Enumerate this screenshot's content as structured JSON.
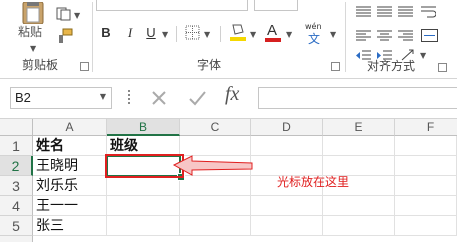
{
  "ribbon": {
    "clipboard": {
      "group_label": "剪贴板",
      "paste_label": "粘贴"
    },
    "font": {
      "group_label": "字体",
      "bold_label": "B",
      "italic_label": "I",
      "underline_label": "U",
      "font_color_glyph": "A",
      "phonetic_label": "wén"
    },
    "alignment": {
      "group_label": "对齐方式"
    }
  },
  "formula_bar": {
    "name_box": "B2",
    "fx_label": "fx",
    "content": ""
  },
  "sheet": {
    "columns": [
      "A",
      "B",
      "C",
      "D",
      "E",
      "F"
    ],
    "rows": [
      "1",
      "2",
      "3",
      "4",
      "5"
    ],
    "cells": {
      "A1": "姓名",
      "B1": "班级",
      "A2": "王晓明",
      "A3": "刘乐乐",
      "A4": "王一一",
      "A5": "张三"
    },
    "selected_cell": "B2"
  },
  "annotation": {
    "text": "光标放在这里",
    "color": "#e02020"
  },
  "colors": {
    "accent_green": "#217346",
    "annotation_red": "#e02020",
    "font_color_red": "#d62020",
    "highlight_yellow": "#f5d800"
  }
}
